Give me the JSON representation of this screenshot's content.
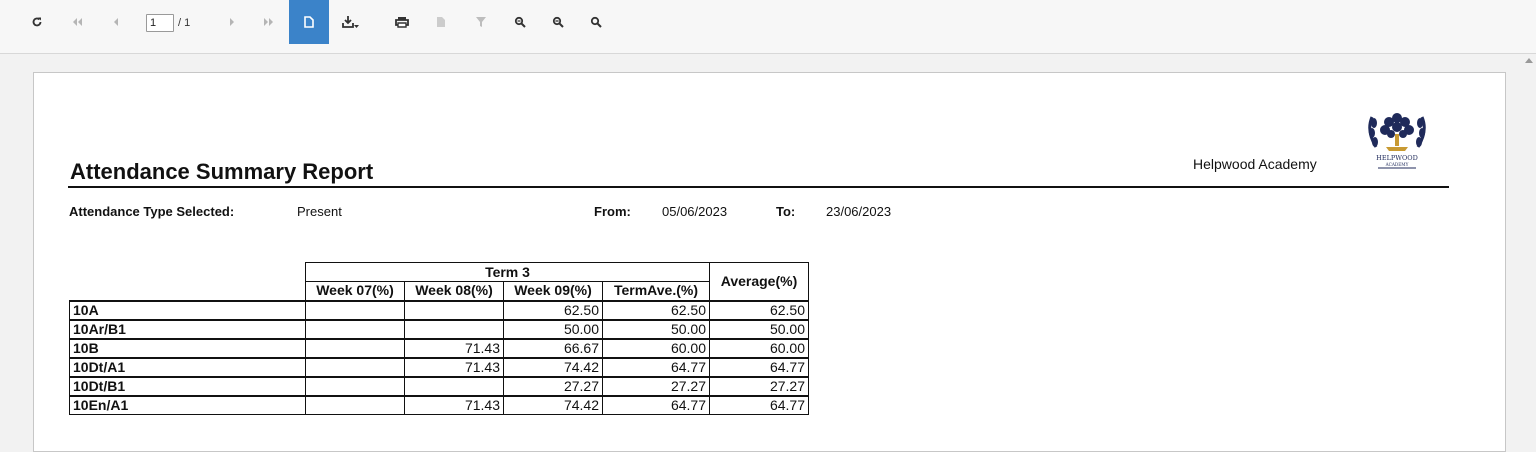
{
  "toolbar": {
    "page_current": "1",
    "page_total": "/ 1",
    "icons": [
      "refresh-icon",
      "first-page-icon",
      "prev-page-icon",
      "next-page-icon",
      "last-page-icon",
      "document-icon",
      "export-icon",
      "print-icon",
      "doc-map-icon",
      "filter-icon",
      "find-icon",
      "zoom-out-icon",
      "zoom-in-icon"
    ],
    "active_color": "#3b83c9"
  },
  "report": {
    "title": "Attendance Summary Report",
    "organization": "Helpwood Academy",
    "logo_text": "HELPWOOD",
    "logo_subtext": "ACADEMY",
    "attendance_type_label": "Attendance Type Selected:",
    "attendance_type_value": "Present",
    "from_label": "From:",
    "from_value": "05/06/2023",
    "to_label": "To:",
    "to_value": "23/06/2023"
  },
  "table": {
    "term_header": "Term 3",
    "average_header": "Average(%)",
    "columns": [
      "Week 07(%)",
      "Week 08(%)",
      "Week 09(%)",
      "TermAve.(%)"
    ],
    "rows": [
      {
        "name": "10A",
        "w07": "",
        "w08": "",
        "w09": "62.50",
        "term": "62.50",
        "avg": "62.50"
      },
      {
        "name": "10Ar/B1",
        "w07": "",
        "w08": "",
        "w09": "50.00",
        "term": "50.00",
        "avg": "50.00"
      },
      {
        "name": "10B",
        "w07": "",
        "w08": "71.43",
        "w09": "66.67",
        "term": "60.00",
        "avg": "60.00"
      },
      {
        "name": "10Dt/A1",
        "w07": "",
        "w08": "71.43",
        "w09": "74.42",
        "term": "64.77",
        "avg": "64.77"
      },
      {
        "name": "10Dt/B1",
        "w07": "",
        "w08": "",
        "w09": "27.27",
        "term": "27.27",
        "avg": "27.27"
      },
      {
        "name": "10En/A1",
        "w07": "",
        "w08": "71.43",
        "w09": "74.42",
        "term": "64.77",
        "avg": "64.77"
      }
    ]
  }
}
